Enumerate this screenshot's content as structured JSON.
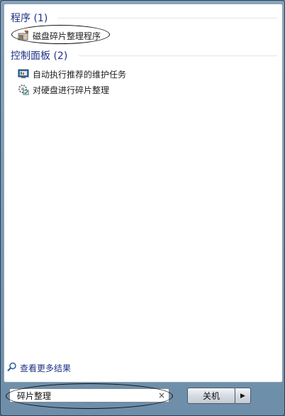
{
  "results": {
    "programs_header": "程序 (1)",
    "programs": [
      {
        "label": "磁盘碎片整理程序",
        "icon": "disk-defragmenter-icon"
      }
    ],
    "control_panel_header": "控制面板 (2)",
    "control_panel": [
      {
        "label": "自动执行推荐的维护任务",
        "icon": "maintenance-icon"
      },
      {
        "label": "对硬盘进行碎片整理",
        "icon": "defrag-settings-icon"
      }
    ]
  },
  "see_more": {
    "label": "查看更多结果",
    "icon": "search-icon"
  },
  "search": {
    "value": "碎片整理",
    "clear": "×"
  },
  "shutdown": {
    "label": "关机",
    "arrow": "▶"
  },
  "colors": {
    "accent": "#1e3287",
    "panel": "#ffffff",
    "chrome": "#6d8ea9"
  }
}
